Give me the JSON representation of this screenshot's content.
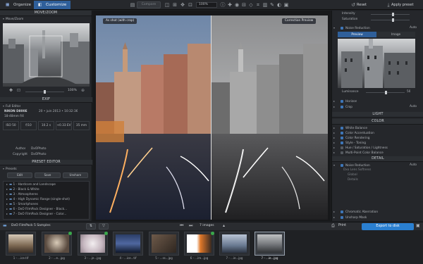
{
  "header": {
    "tab_organize": "Organize",
    "tab_customize": "Customize",
    "compare": "Compare",
    "zoom": "100%",
    "reset": "Reset",
    "apply_preset": "Apply preset"
  },
  "left": {
    "move_zoom": {
      "title": "MOVE/ZOOM",
      "sub": "Move/Zoom",
      "zoom_value": "100%"
    },
    "exif": {
      "title": "EXIF",
      "full_editor": "Full Editor",
      "camera": "NIKON D800E",
      "date": "20 • juin 2013 • 10:32:36",
      "lens_info": "18-48mm f/4",
      "values": [
        "ISO 50",
        "f/10",
        "10.2 s",
        "+0.33 EV",
        "35 mm"
      ],
      "author_label": "Author",
      "author": "DxOPhoto",
      "copyright_label": "Copyright",
      "copyright": "DxOPhoto"
    },
    "presets": {
      "title": "PRESET EDITOR",
      "sub": "Presets",
      "buttons": [
        "Edit",
        "Save",
        "Unshare"
      ],
      "items": [
        "1 - Hardcore and Landscape",
        "2 - Black & White",
        "3 - Atmospheres",
        "4 - High Dynamic Range (single-shot)",
        "5 - Smartphones",
        "6 - DxO FilmPack Designer - Black...",
        "7 - DxO FilmPack Designer - Color..."
      ]
    }
  },
  "center": {
    "label_left": "As shot (with crop)",
    "label_right": "Correction Preview"
  },
  "right": {
    "top_rows": [
      "Intensity",
      "Saturation"
    ],
    "noise": {
      "label": "Noise Reduction",
      "mode": "Auto",
      "tab1": "Preview",
      "tab2": "Image"
    },
    "luminance": {
      "label": "Luminance",
      "value": "50"
    },
    "misc_rows": [
      "Horizon",
      "Crop"
    ],
    "crop_mode": "Auto",
    "light": "LIGHT",
    "color": {
      "title": "COLOR",
      "items": [
        "White Balance",
        "Color Accentuation",
        "Color Rendering",
        "Style - Toning",
        "Hue / Saturation / Lightness",
        "Multi-Point Color Balance"
      ]
    },
    "detail": {
      "title": "DETAIL",
      "items": [
        "Noise Reduction",
        "Dxo Lens Softness",
        "Global",
        "Details"
      ],
      "detail_mode": "Auto",
      "extra": [
        "Chromatic Aberration",
        "Unsharp Mask"
      ]
    }
  },
  "filmbar": {
    "path": "DxO FilmPack 5 Samples",
    "count": "7 images",
    "print": "Print",
    "export": "Export to disk"
  },
  "thumbs": [
    "1 - ...ice.tif",
    "2 - ...e...jpg",
    "3 - ...je...jpg",
    "4 - ...ice...tif",
    "5 - ...ss...jpg",
    "6 - ...ire...jpg",
    "7 - ...ie...jpg"
  ],
  "colors": {
    "accent": "#2f5f9a",
    "export": "#2a7fd0"
  }
}
